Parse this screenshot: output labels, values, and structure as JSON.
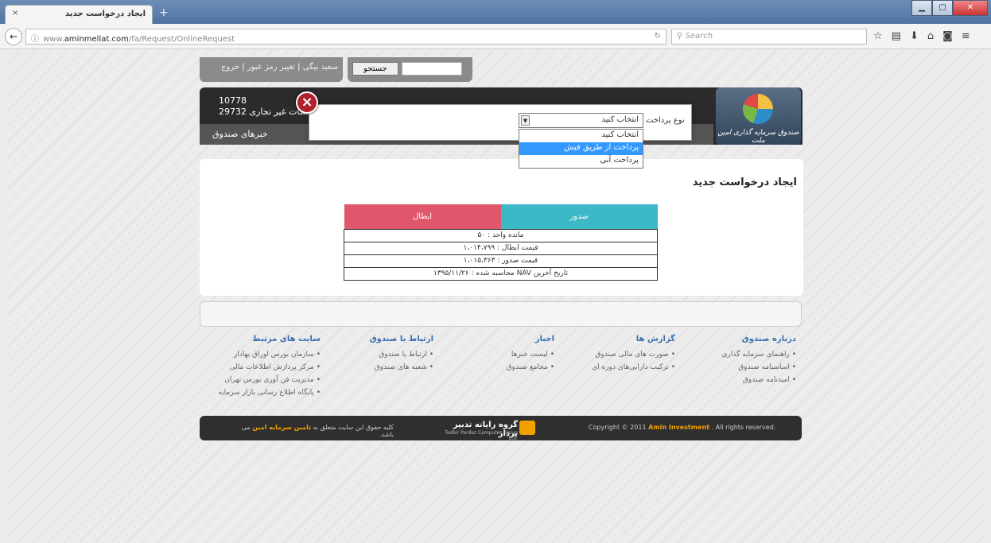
{
  "browser": {
    "tab_title": "ایجاد درخواست جدید",
    "tab_close": "×",
    "new_tab": "+",
    "url_prefix": "www.",
    "url_domain": "aminmellat.com",
    "url_path": "/fa/Request/OnlineRequest",
    "search_placeholder": "Search"
  },
  "topbar": {
    "user_name": "سعید بیگی",
    "change_password": "تغییر رمز عبور",
    "logout": "خروج",
    "search_button": "جستجو"
  },
  "header": {
    "number_1": "10778",
    "number_2": "29732",
    "subtitle": "موسسات غیر تجاری",
    "logo_caption": "صندوق سرمایه گذاری امین ملت",
    "menu_item": "خبرهای صندوق"
  },
  "modal": {
    "close_label": "×",
    "payment_type_label": "نوع پرداخت",
    "selected_option": "انتخاب کنید",
    "options": [
      "انتخاب کنید",
      "پرداخت از طریق فیش",
      "پرداخت آنی"
    ]
  },
  "content": {
    "title": "ایجاد درخواست جدید",
    "issue_button": "صدور",
    "cancel_button": "ابطال",
    "rows": [
      "مانده واحد : ۵۰",
      "قیمت ابطال : ۱،۰۱۴،۷۹۹",
      "قیمت صدور : ۱،۰۱۵،۳۶۳",
      "تاریخ آخرین NAV محاسبه شده : ۱۳۹۵/۱۱/۲۶"
    ]
  },
  "footer_columns": [
    {
      "title": "درباره صندوق",
      "items": [
        "راهنمای سرمایه گذاری",
        "اساسنامه صندوق",
        "امیدنامه صندوق"
      ]
    },
    {
      "title": "گزارش ها",
      "items": [
        "صورت های مالی صندوق",
        "ترکیب دارایی‌های دوره ای"
      ]
    },
    {
      "title": "اخبار",
      "items": [
        "لیست خبرها",
        "مجامع صندوق"
      ]
    },
    {
      "title": "ارتباط با صندوق",
      "items": [
        "ارتباط با صندوق",
        "شعبه های صندوق"
      ]
    },
    {
      "title": "سایت های مرتبط",
      "items": [
        "سازمان بورس اوراق بهادار",
        "مرکز پردازش اطلاعات مالی",
        "مدیریت فن آوری بورس تهران",
        "پایگاه اطلاع رسانی بازار سرمایه"
      ]
    }
  ],
  "footer": {
    "copyright_prefix": "Copyright © 2011",
    "copyright_brand": "Amin Investment",
    "copyright_suffix": ". All rights reserved.",
    "tadbir_title": "گروه رایانه تدبیر پرداز",
    "tadbir_sub": "Tadbir Pardaz Computer Group Ltd.",
    "rights_prefix": "کلیه حقوق این سایت متعلق به",
    "rights_brand": "تامین سرمایه امین",
    "rights_suffix": "می باشد."
  },
  "colors": {
    "issue": "#3cb8c6",
    "cancel": "#e0566b",
    "accent": "#f2a100",
    "link": "#3a6fb0"
  }
}
